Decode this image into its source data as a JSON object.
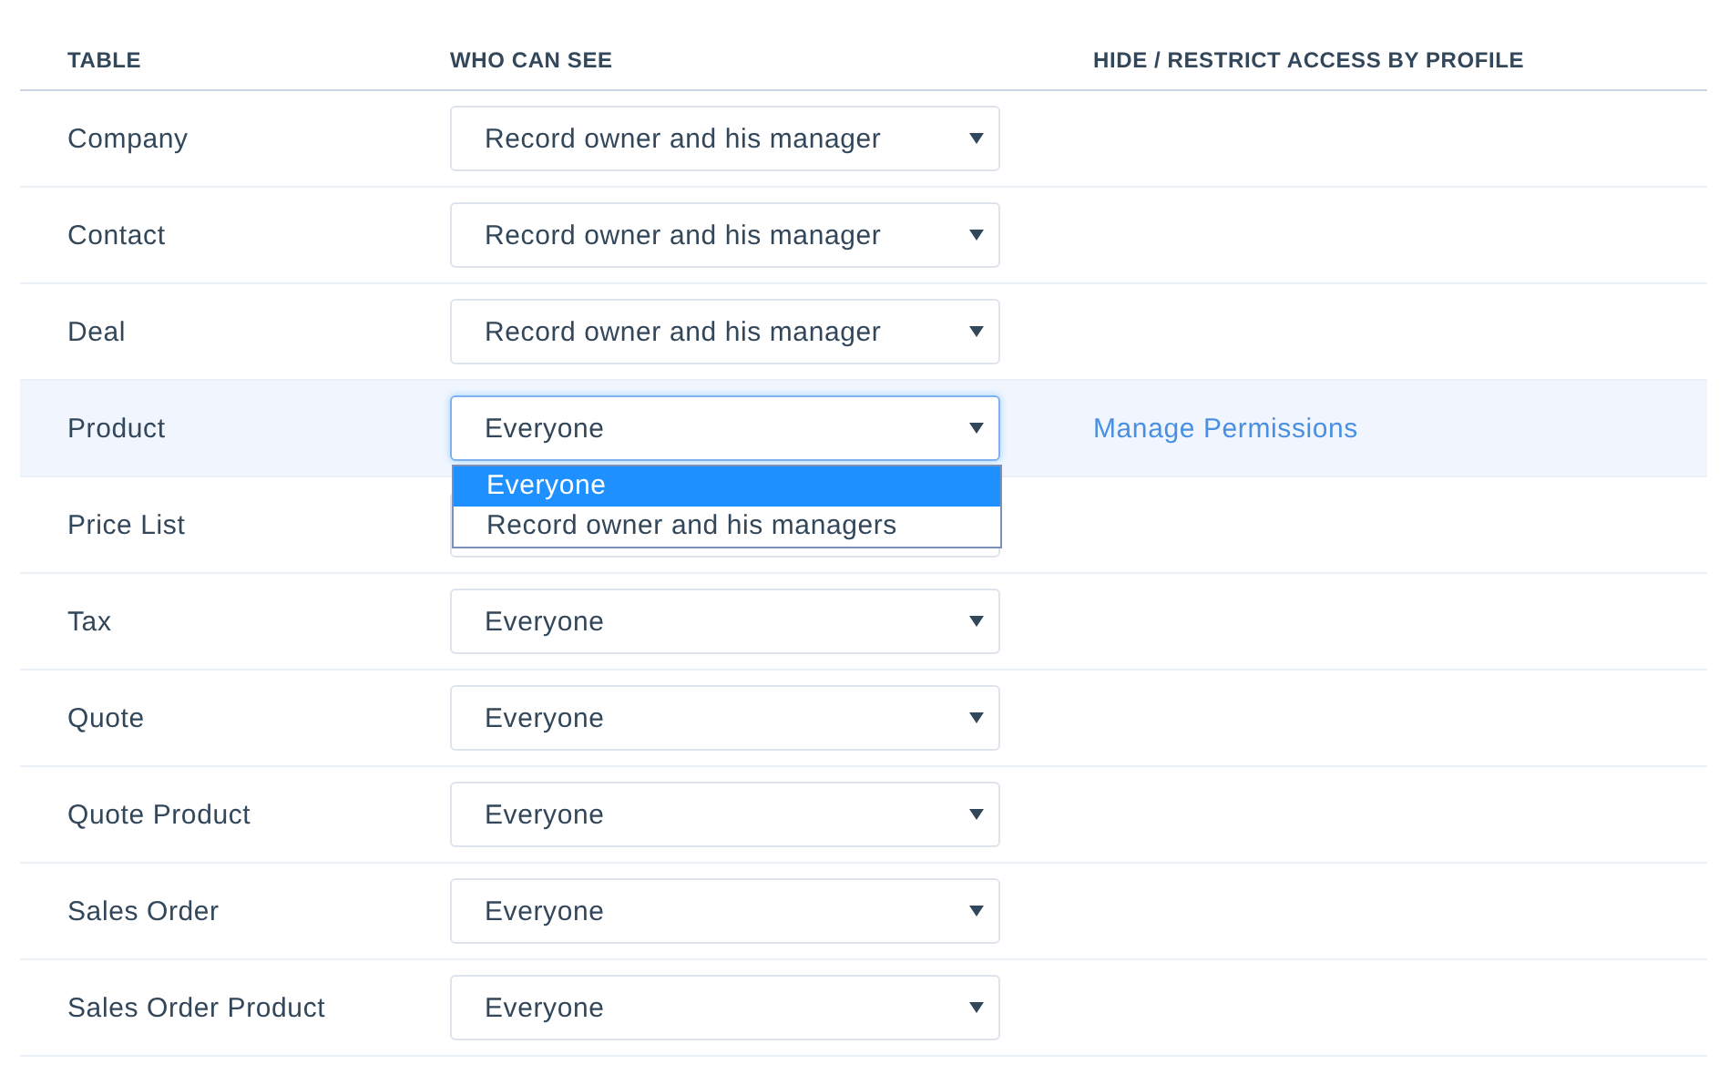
{
  "columns": [
    "TABLE",
    "WHO CAN SEE",
    "HIDE / RESTRICT ACCESS BY PROFILE"
  ],
  "rows": [
    {
      "table": "Company",
      "value": "Record owner and his manager",
      "highlighted": false
    },
    {
      "table": "Contact",
      "value": "Record owner and his manager",
      "highlighted": false
    },
    {
      "table": "Deal",
      "value": "Record owner and his manager",
      "highlighted": false
    },
    {
      "table": "Product",
      "value": "Everyone",
      "highlighted": true,
      "link": "Manage Permissions",
      "options": [
        {
          "label": "Everyone",
          "selected": true
        },
        {
          "label": "Record owner and his managers",
          "selected": false
        }
      ]
    },
    {
      "table": "Price List",
      "highlighted": false
    },
    {
      "table": "Tax",
      "value": "Everyone",
      "highlighted": false
    },
    {
      "table": "Quote",
      "value": "Everyone",
      "highlighted": false
    },
    {
      "table": "Quote Product",
      "value": "Everyone",
      "highlighted": false
    },
    {
      "table": "Sales Order",
      "value": "Everyone",
      "highlighted": false
    },
    {
      "table": "Sales Order Product",
      "value": "Everyone",
      "highlighted": false
    }
  ]
}
